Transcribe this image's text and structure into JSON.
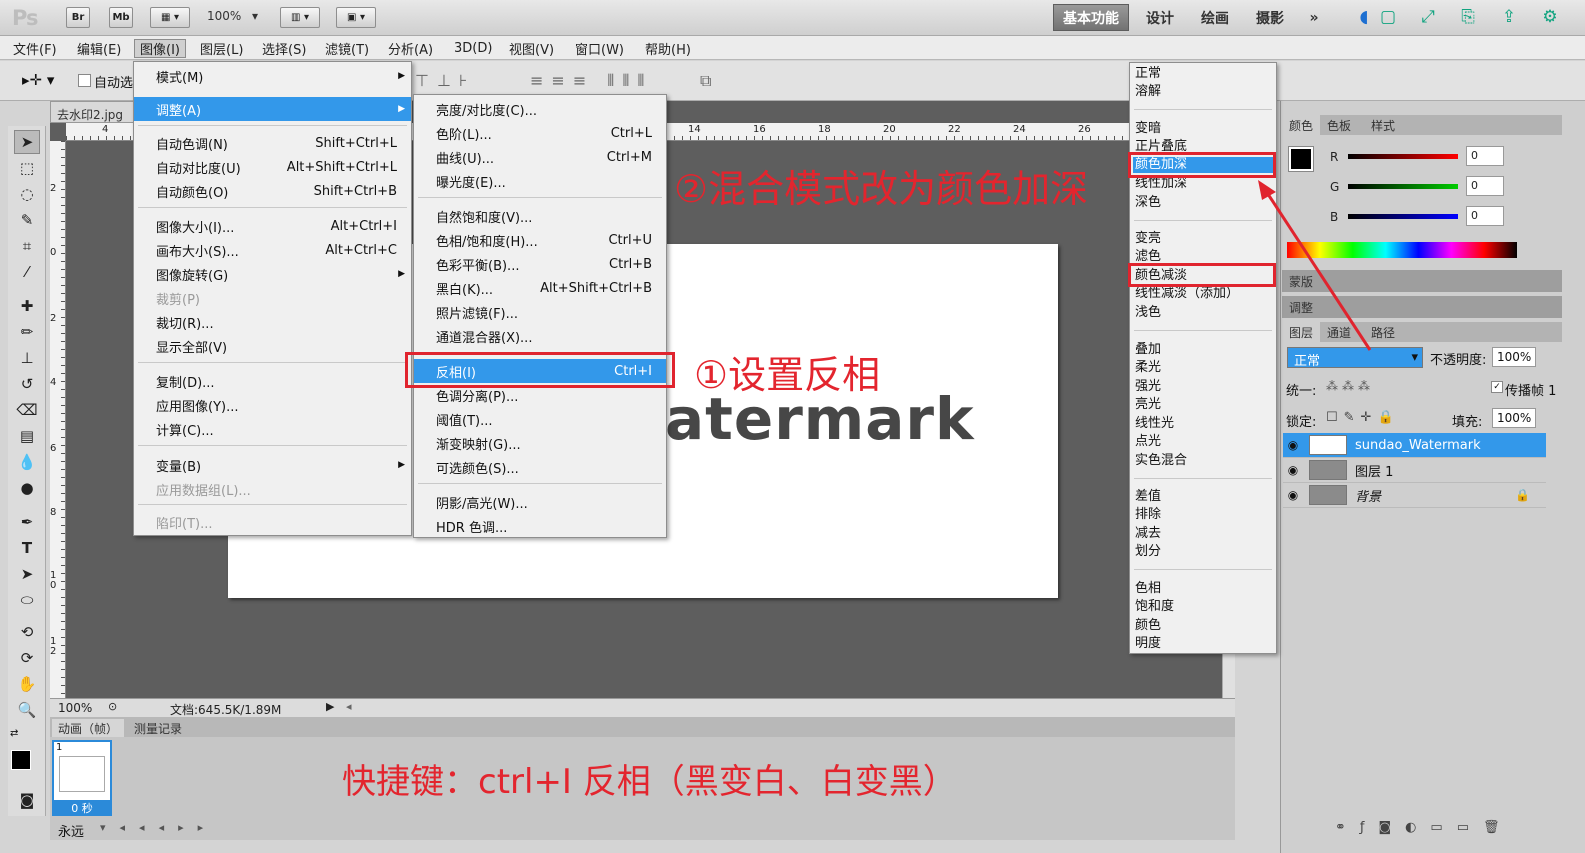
{
  "topbar": {
    "logo": "Ps",
    "br": "Br",
    "mb": "Mb",
    "zoom": "100%",
    "workspaces": [
      "基本功能",
      "设计",
      "绘画",
      "摄影"
    ],
    "more": "»"
  },
  "menubar": [
    "文件(F)",
    "编辑(E)",
    "图像(I)",
    "图层(L)",
    "选择(S)",
    "滤镜(T)",
    "分析(A)",
    "3D(D)",
    "视图(V)",
    "窗口(W)",
    "帮助(H)"
  ],
  "options": {
    "auto_select": "自动选"
  },
  "document": {
    "tab": "去水印2.jpg",
    "watermark_text": "atermark",
    "zoom": "100%",
    "doc_info": "文档:645.5K/1.89M",
    "ruler_h": [
      "4",
      "14",
      "16",
      "18",
      "20",
      "22",
      "24",
      "26"
    ],
    "ruler_v": [
      "2",
      "0",
      "2",
      "4",
      "6",
      "8",
      "1\n0",
      "1\n2"
    ]
  },
  "image_menu": {
    "items": [
      {
        "label": "模式(M)",
        "sub": true
      },
      {
        "label": "调整(A)",
        "sub": true,
        "highlight": true
      },
      {
        "label": "自动色调(N)",
        "shortcut": "Shift+Ctrl+L"
      },
      {
        "label": "自动对比度(U)",
        "shortcut": "Alt+Shift+Ctrl+L"
      },
      {
        "label": "自动颜色(O)",
        "shortcut": "Shift+Ctrl+B"
      },
      {
        "label": "图像大小(I)...",
        "shortcut": "Alt+Ctrl+I"
      },
      {
        "label": "画布大小(S)...",
        "shortcut": "Alt+Ctrl+C"
      },
      {
        "label": "图像旋转(G)",
        "sub": true
      },
      {
        "label": "裁剪(P)",
        "disabled": true
      },
      {
        "label": "裁切(R)..."
      },
      {
        "label": "显示全部(V)"
      },
      {
        "label": "复制(D)..."
      },
      {
        "label": "应用图像(Y)..."
      },
      {
        "label": "计算(C)..."
      },
      {
        "label": "变量(B)",
        "sub": true
      },
      {
        "label": "应用数据组(L)...",
        "disabled": true
      },
      {
        "label": "陷印(T)...",
        "disabled": true
      }
    ]
  },
  "adjust_menu": {
    "items": [
      {
        "label": "亮度/对比度(C)..."
      },
      {
        "label": "色阶(L)...",
        "shortcut": "Ctrl+L"
      },
      {
        "label": "曲线(U)...",
        "shortcut": "Ctrl+M"
      },
      {
        "label": "曝光度(E)..."
      },
      {
        "label": "自然饱和度(V)..."
      },
      {
        "label": "色相/饱和度(H)...",
        "shortcut": "Ctrl+U"
      },
      {
        "label": "色彩平衡(B)...",
        "shortcut": "Ctrl+B"
      },
      {
        "label": "黑白(K)...",
        "shortcut": "Alt+Shift+Ctrl+B"
      },
      {
        "label": "照片滤镜(F)..."
      },
      {
        "label": "通道混合器(X)..."
      },
      {
        "label": "反相(I)",
        "shortcut": "Ctrl+I",
        "highlight": true
      },
      {
        "label": "色调分离(P)..."
      },
      {
        "label": "阈值(T)..."
      },
      {
        "label": "渐变映射(G)..."
      },
      {
        "label": "可选颜色(S)..."
      },
      {
        "label": "阴影/高光(W)..."
      },
      {
        "label": "HDR 色调..."
      }
    ]
  },
  "blend_menu": {
    "items": [
      "正常",
      "溶解",
      "变暗",
      "正片叠底",
      "颜色加深",
      "线性加深",
      "深色",
      "变亮",
      "滤色",
      "颜色减淡",
      "线性减淡（添加）",
      "浅色",
      "叠加",
      "柔光",
      "强光",
      "亮光",
      "线性光",
      "点光",
      "实色混合",
      "差值",
      "排除",
      "减去",
      "划分",
      "色相",
      "饱和度",
      "颜色",
      "明度"
    ],
    "highlighted": "颜色加深"
  },
  "annotations": {
    "step2": "②混合模式改为颜色加深",
    "step1": "①设置反相",
    "shortcut": "快捷键：ctrl+I 反相（黑变白、白变黑）"
  },
  "color_panel": {
    "tabs": [
      "颜色",
      "色板",
      "样式"
    ],
    "channels": [
      {
        "name": "R",
        "value": "0"
      },
      {
        "name": "G",
        "value": "0"
      },
      {
        "name": "B",
        "value": "0"
      }
    ]
  },
  "mask_panel": "蒙版",
  "adjust_panel": "调整",
  "layers_panel": {
    "tabs": [
      "图层",
      "通道",
      "路径"
    ],
    "blend_mode": "正常",
    "opacity_label": "不透明度:",
    "opacity": "100%",
    "unify_label": "统一:",
    "propagate": "传播帧 1",
    "lock_label": "锁定:",
    "fill_label": "填充:",
    "fill": "100%",
    "layers": [
      "sundao_Watermark",
      "图层 1",
      "背景"
    ]
  },
  "animation": {
    "tabs": [
      "动画（帧）",
      "测量记录"
    ],
    "frame_no": "1",
    "frame_time": "0 秒",
    "loop": "永远"
  }
}
